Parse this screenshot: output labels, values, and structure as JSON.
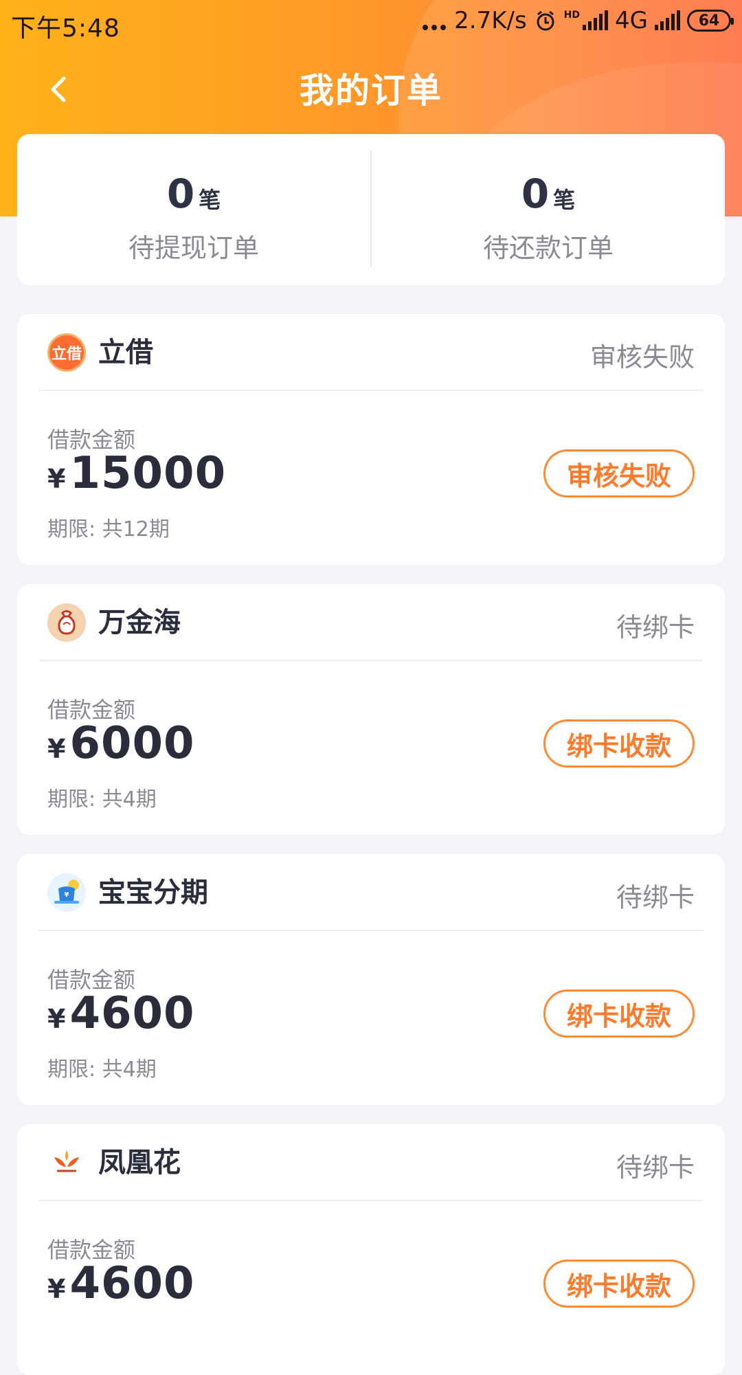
{
  "status_bar": {
    "time": "下午5:48",
    "network_speed": "2.7K/s",
    "network_type": "4G",
    "hd_badge": "HD",
    "battery": "64",
    "icons": [
      "more-dots-icon",
      "alarm-icon",
      "signal-bars-icon",
      "battery-icon"
    ]
  },
  "header": {
    "title": "我的订单",
    "back_icon": "chevron-left-icon",
    "gradient_colors": [
      "#ffb21a",
      "#ff9c25",
      "#ff8a3a",
      "#ff6e3f"
    ]
  },
  "summary": {
    "pending_withdraw": {
      "count": "0",
      "unit": "笔",
      "label": "待提现订单"
    },
    "pending_repayment": {
      "count": "0",
      "unit": "笔",
      "label": "待还款订单"
    }
  },
  "loans": [
    {
      "name": "立借",
      "status": "审核失败",
      "amount_label": "借款金额",
      "currency": "¥",
      "amount": "15000",
      "term": "期限: 共12期",
      "action": "审核失败",
      "logo_text": "立借"
    },
    {
      "name": "万金海",
      "status": "待绑卡",
      "amount_label": "借款金额",
      "currency": "¥",
      "amount": "6000",
      "term": "期限: 共4期",
      "action": "绑卡收款",
      "logo_text": "万金海"
    },
    {
      "name": "宝宝分期",
      "status": "待绑卡",
      "amount_label": "借款金额",
      "currency": "¥",
      "amount": "4600",
      "term": "期限: 共4期",
      "action": "绑卡收款",
      "logo_text": "宝宝分期"
    },
    {
      "name": "凤凰花",
      "status": "待绑卡",
      "amount_label": "借款金额",
      "currency": "¥",
      "amount": "4600",
      "term": "",
      "action": "绑卡收款",
      "logo_text": "凤凰花"
    }
  ],
  "theme": {
    "accent": "#ff7a2a",
    "background": "#f4f4f8",
    "text_primary": "#2b2d3d",
    "text_secondary": "#8a8a95"
  }
}
